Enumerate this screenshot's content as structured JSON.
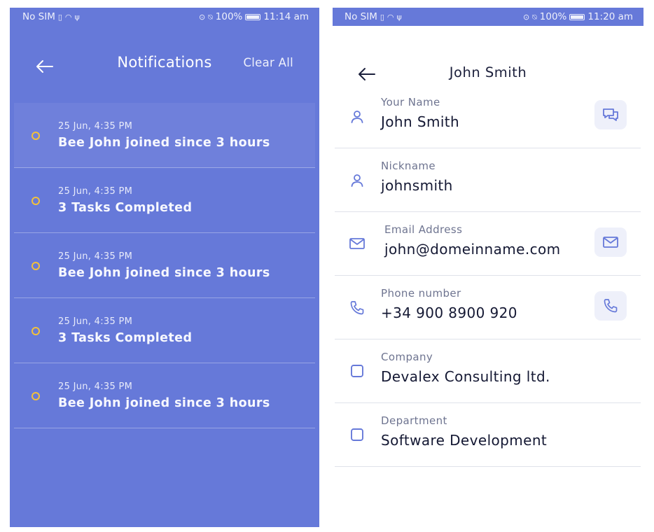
{
  "colors": {
    "primary": "#6679d9",
    "dot": "#f3c13a",
    "text_dark": "#141833",
    "label": "#6e7490"
  },
  "notifications_screen": {
    "status": {
      "carrier": "No SIM",
      "battery": "100%",
      "time": "11:14 am"
    },
    "title": "Notifications",
    "clear_all": "Clear All",
    "items": [
      {
        "time": "25 Jun, 4:35 PM",
        "text": "Bee John joined since 3 hours"
      },
      {
        "time": "25 Jun, 4:35 PM",
        "text": "3 Tasks Completed"
      },
      {
        "time": "25 Jun, 4:35 PM",
        "text": "Bee John joined since 3 hours"
      },
      {
        "time": "25 Jun, 4:35 PM",
        "text": "3 Tasks Completed"
      },
      {
        "time": "25 Jun, 4:35 PM",
        "text": "Bee John joined since 3 hours"
      }
    ]
  },
  "profile_screen": {
    "status": {
      "carrier": "No SIM",
      "battery": "100%",
      "time": "11:20 am"
    },
    "title": "John Smith",
    "fields": [
      {
        "label": "Your Name",
        "value": "John Smith",
        "icon": "user-icon",
        "action": "chat-icon"
      },
      {
        "label": "Nickname",
        "value": "johnsmith",
        "icon": "user-icon",
        "action": null
      },
      {
        "label": "Email Address",
        "value": "john@domeinname.com",
        "icon": "mail-icon",
        "action": "mail-icon"
      },
      {
        "label": "Phone number",
        "value": "+34 900 8900 920",
        "icon": "phone-icon",
        "action": "phone-icon"
      },
      {
        "label": "Company",
        "value": "Devalex Consulting ltd.",
        "icon": "square-icon",
        "action": null
      },
      {
        "label": "Department",
        "value": "Software Development",
        "icon": "square-icon",
        "action": null
      }
    ]
  }
}
